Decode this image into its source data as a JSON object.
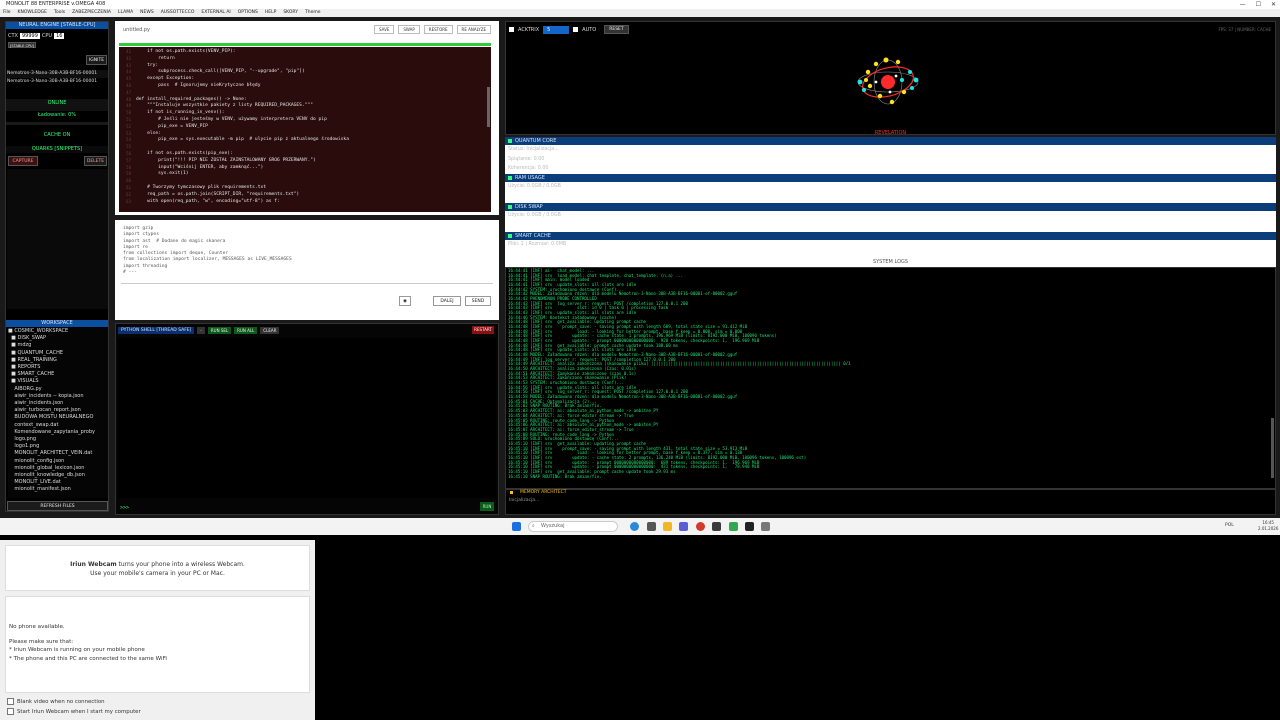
{
  "window": {
    "title": "MONOLIT 88 ENTERPRISE v.OMEGA 408",
    "min": "—",
    "max": "☐",
    "close": "✕"
  },
  "menu": [
    "File",
    "KNOWLEDGE",
    "Tools",
    "ZABEZPIECZENIA",
    "LLAMA",
    "NEWS",
    "AUSSOTTECCO",
    "EXTERNAL AI",
    "OPTIONS",
    "HELP",
    "SKORY",
    "Theme"
  ],
  "left": {
    "engine_title": "NEURAL ENGINE [STABLE-CPU]",
    "ctx_label": "CTX",
    "ctx_value": "99999",
    "cpu_label": "CPU",
    "cpu_value": "16",
    "small_btn": "[STABLE CPU]",
    "ignite": "IGNITE",
    "model_1": "Nemotron-3-Nano-30B-A3B-BF16-00001",
    "model_2": "Nemotron-3-Nano-30B-A3B-BF16-00001",
    "online": "ONLINE",
    "loading": "Ładowanie: 0%",
    "cache_on": "CACHE ON",
    "quarks_title": "QUARKS [SNIPPETS]",
    "capture": "CAPTURE",
    "delete": "DELETE",
    "workspace_title": "WORKSPACE",
    "tree": [
      "■ COSMIC_WORKSPACE",
      "  ■ DISK_SWAP",
      "  ■ mdzg",
      "  ■ QUANTUM_CACHE",
      "  ■ REAL_TRAINING",
      "  ■ REPORTS",
      "  ■ SMART_CACHE",
      "  ■ VISUALS",
      "    AIBORG.py",
      "    aiwir_incidents -- kopia.json",
      "    aiwir_incidents.json",
      "    aiwir_turbocan_report.json",
      "    BUDOWA MOSTU NEURALNEGO",
      "    context_swap.dat",
      "    Komendowane_zapytania_proby",
      "    logo.png",
      "    logo1.png",
      "    MONOLIT_ARCHITECT_VEIN.dat",
      "    mionolit_config.json",
      "    mionolit_global_lexicon.json",
      "    mionolit_knowledge_db.json",
      "    MONOLIT_LIVE.dat",
      "    mionolit_manifest.json"
    ],
    "refresh": "REFRESH FILES"
  },
  "editor": {
    "tab": "untitled.py",
    "buttons": [
      "SAVE",
      "SWAP",
      "RESTORE",
      "RE ANALYZE"
    ],
    "code": [
      "    if not os.path.exists(VENV_PIP):",
      "        return",
      "    try:",
      "        subprocess.check_call([VENV_PIP, \"--upgrade\", \"pip\"])",
      "    except Exception:",
      "        pass  # Ignorujemy nieKrytyczne błędy",
      "",
      "def install_required_packages() -> None:",
      "    \"\"\"Instaluje wszystkie pakiety z listy REQUIRED_PACKAGES.\"\"\"",
      "    if not is_running_in_venv():",
      "        # Jeśli nie jesteśmy w VENV, używamy interpretera VENV do pip",
      "        pip_exe = VENV_PIP",
      "    else:",
      "        pip_exe = sys.executable -m pip  # ulycie pip z aktualnego środowiska",
      "",
      "    if not os.path.exists(pip_exe):",
      "        print(\"!!! PIP NIE ZOSTAŁ ZAINSTALOWANY GRO6 PRZERWANY.\")",
      "        input(\"Wciśnij ENTER, aby zamknąć...\")",
      "        sys.exit(1)",
      "",
      "    # Tworzymy tymczasowy plik requirements.txt",
      "    req_path = os.path.join(SCRIPT_DIR, \"requirements.txt\")",
      "    with open(req_path, \"w\", encoding=\"utf-8\") as f:"
    ],
    "line_numbers": [
      "41",
      "42",
      "43",
      "44",
      "45",
      "46",
      "47",
      "48",
      "49",
      "50",
      "51",
      "52",
      "53",
      "54",
      "55",
      "56",
      "57",
      "58",
      "59",
      "60",
      "61",
      "62",
      "63"
    ]
  },
  "prompt": {
    "text": [
      "import gzip",
      "import ctypes",
      "import ast  # Dodane do magic skanera",
      "import re",
      "from collections import deque, Counter",
      "from localization import localizer, MESSAGES as LIVE_MESSAGES",
      "import threading",
      "# ---"
    ],
    "icon": "◉",
    "dalej": "DALEJ",
    "send": "SEND"
  },
  "shell": {
    "title": "PYTHON SHELL [THREAD SAFE]",
    "buttons": [
      "-",
      "RUN SEL",
      "RUN ALL",
      "CLEAR"
    ],
    "restart": "RESTART",
    "prompt": ">>>",
    "run": "RUN"
  },
  "right": {
    "actrix_label": "ACKTRIX",
    "actrix_value": "5",
    "auto_label": "AUTO",
    "reset": "RESET",
    "fps": "FPS: 37  |  NUMBER: CACHE",
    "revelation": "REVELATION",
    "sections": [
      {
        "title": "QUANTUM CORE",
        "lines": [
          "Status: Inicjalizacja...",
          "Splątanie: 0.00",
          "Koherencja: 0.00"
        ]
      },
      {
        "title": "RAM USAGE",
        "lines": [
          "Użycie: 0.0GB / 0.0GB"
        ]
      },
      {
        "title": "DISK SWAP",
        "lines": [
          "Użycie: 0.0GB / 0.0GB"
        ]
      },
      {
        "title": "SMART CACHE",
        "lines": [
          "Pliki: 2  |  Rozmiar: 0.0MB"
        ]
      }
    ],
    "syslog_title": "SYSTEM LOGS",
    "log": [
      "16:44:41 [INF] ai-  chat_model: ...",
      "16:44:41 [INF] srv  load_model: chat template, chat_template: (n.a) ...",
      "16:44:41 [INF] main: model loaded",
      "16:44:41 [INF] srv  update_slots: all slots are idle",
      "16:44:42 SYSTEM: uruchomiono dostawcę (Conf)...",
      "16:44:42 MODEL: Załadowano rdzeń: dla modelu Nemotron-3-Nano-30B-A3B-BF16-00001-of-00002.gguf",
      "16:44:43 PHENOMENON PROBE CONTROLLED",
      "16:44:43 [INF] srv  log_server_r: request: POST /completion 127.0.0.1 200",
      "16:44:43 [INF] srv          slot: id 0 | task 0 | processing task",
      "16:44:43 [INF] srv  update_slots: all slots are idle",
      "16:44:46 SYSTEM: Kontekst załadowany (cache)",
      "16:44:48 [INF] srv  get_available: updating prompt cache",
      "16:44:48 [INF] srv    prompt_save: - saving prompt with length 689, total state size = 91.412 MiB",
      "16:44:48 [INF] srv          load: - looking for better prompt, base f_keep = 0.000, sim = 0.000",
      "16:44:48 [INF] srv        update: - cache state: 1 prompts, 196.969 MiB (limits: 8192.000 MiB, 100096 tokens)",
      "16:44:48 [INF] srv        update: - prompt 0000000000000000:  928 tokens, checkpoints: 1,  196.969 MiB",
      "16:44:48 [INF] srv  get_available: prompt cache update took 188.60 ms",
      "16:44:48 [INF] srv  update_slots: all slots are idle",
      "16:44:48 MODEL: Załadowano rdzeń: dla modelu Nemotron-3-Nano-30B-A3B-BF16-00001-of-00002.gguf",
      "16:44:49 [INF] log_server_r: request: POST /completion 127.0.0.1 200",
      "16:44:49 ARCHITECT: analiza zakończona [skanowanie pliku] ||||||||||||||||||||||||||||||||||||||||||||||||||||||||||||||||||||||||||||| 0/1",
      "16:44:50 ARCHITECT: analiza zakończona (Czas: 0.01s)",
      "16:44:51 ARCHITECT: Zamykanie zakończone (czas 0.1s)",
      "16:44:53 ARCHITECT: Zakończono skanowanie (Plik)",
      "16:44:53 SYSTEM: uruchomiono dostawcę (Conf)...",
      "16:44:56 [INF] srv  update_slots: all slots are idle",
      "16:44:56 [INF] srv  log_server_r: request: POST /completion 127.0.0.1 200",
      "16:44:58 MODEL: Załadowano rdzeń: dla modelu Nemotron-3-Nano-30B-A3B-BF16-00001-of-00002.gguf",
      "16:45:01 CACHE: Optymalizacja (2)...",
      "16:45:02 SNAP ROUTING: Brak zmian/fix.",
      "16:45:03 ARCHITECT: ai: absolute_ai_python_mode -> ambitne_PY",
      "16:45:04 ARCHITECT: ai: force editor stream -> True",
      "16:45:05 ROUTING: route_code_lang -> Python",
      "16:45:06 ARCHITECT: ai: absolute_ai_python_mode -> ambitne_PY",
      "16:45:07 ARCHITECT: ai: force_editor_stream -> True",
      "16:45:08 ROUTING: route_code_lang -> Python",
      "16:45:09 SOLO: uruchomiono dostawcę (Conf)...",
      "16:45:10 [INF] srv  get_available: updating prompt cache",
      "16:45:10 [INF] srv    prompt_save: - saving prompt with length 431, total state size = 53.913 MiB",
      "16:45:10 [INF] srv          load: - looking for better prompt, base f_keep = 0.377, sim = 0.138",
      "16:45:10 [INF] srv        update: - cache state: 2 prompts, 136.240 MiB (limits: 8192.000 MiB, 100096 tokens, 100096 est)",
      "16:45:10 [INF] srv        update: - prompt 0000000000000000:  689 tokens, checkpoints: 1,  196.969 MiB",
      "16:45:10 [INF] srv        update: - prompt 0000000000000000:  431 tokens, checkpoints: 1,   78.940 MiB",
      "16:45:10 [INF] srv  get_available: prompt cache update took 29.93 ms",
      "16:45:10 SNAP ROUTING: Brak zmian/fix."
    ],
    "memory_title": "MEMORY ARCHITECT",
    "memory_line": "Inicjalizacja..."
  },
  "taskbar": {
    "search": "Wyszukaj",
    "lang": "POL",
    "time": "16:45",
    "date": "2.01.2026"
  },
  "iriun": {
    "brand": "Iriun Webcam",
    "headline_rest": " turns your phone into a wireless Webcam.",
    "subline": "Use your mobile's camera in your PC or Mac.",
    "no_phone": "No phone available.",
    "make_sure": "Please make sure that:",
    "bullet_1": "* Iriun Webcam is running on your mobile phone",
    "bullet_2": "* The phone and this PC are connected to the same WiFi",
    "check_1": "Blank video when no connection",
    "check_2": "Start Iriun Webcam when I start my computer"
  }
}
